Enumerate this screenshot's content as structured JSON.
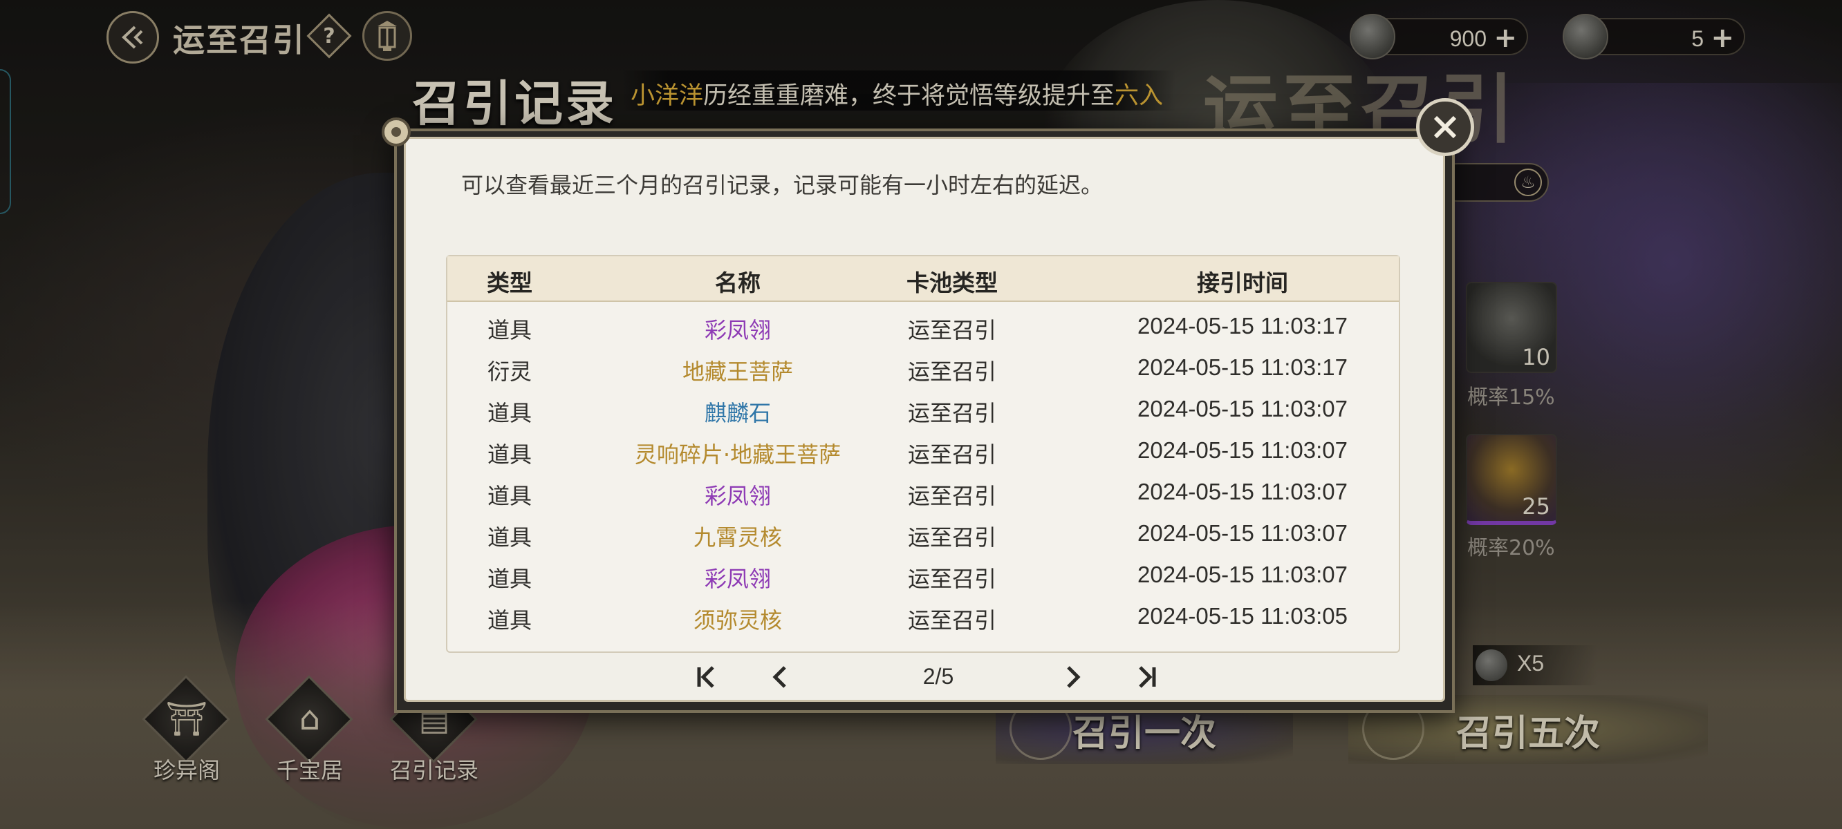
{
  "header": {
    "title": "运至召引",
    "help_label": "?",
    "currencies": [
      {
        "icon": "jade-coin-icon",
        "value": "900",
        "plus": "+"
      },
      {
        "icon": "spirit-token-icon",
        "value": "5",
        "plus": "+"
      }
    ]
  },
  "broadcast": {
    "name": "小洋洋",
    "text": "历经重重磨难，终于将觉悟等级提升至",
    "level": "六入"
  },
  "banner": {
    "title": "运至召引"
  },
  "pool_panel": {
    "rewards": [
      {
        "icon": "lotus-chest-icon",
        "count": "10",
        "rate": "概率15%"
      },
      {
        "icon": "feather-icon",
        "count": "25",
        "rate": "概率20%"
      }
    ],
    "cost_label": "X5",
    "summon_one": "召引一次",
    "summon_five": "召引五次"
  },
  "bottom_nav": [
    {
      "label": "珍异阁",
      "icon": "merchant-hat-icon"
    },
    {
      "label": "千宝居",
      "icon": "pavilion-icon"
    },
    {
      "label": "召引记录",
      "icon": "record-book-icon"
    }
  ],
  "modal": {
    "title": "召引记录",
    "description": "可以查看最近三个月的召引记录，记录可能有一小时左右的延迟。",
    "columns": [
      "类型",
      "名称",
      "卡池类型",
      "接引时间"
    ],
    "rows": [
      {
        "type": "道具",
        "name": "彩凤翎",
        "pool": "运至召引",
        "time": "2024-05-15 11:03:17",
        "color": "#8e3bb5"
      },
      {
        "type": "衍灵",
        "name": "地藏王菩萨",
        "pool": "运至召引",
        "time": "2024-05-15 11:03:17",
        "color": "#b48a2e"
      },
      {
        "type": "道具",
        "name": "麒麟石",
        "pool": "运至召引",
        "time": "2024-05-15 11:03:07",
        "color": "#2f76a8"
      },
      {
        "type": "道具",
        "name": "灵响碎片·地藏王菩萨",
        "pool": "运至召引",
        "time": "2024-05-15 11:03:07",
        "color": "#b48a2e"
      },
      {
        "type": "道具",
        "name": "彩凤翎",
        "pool": "运至召引",
        "time": "2024-05-15 11:03:07",
        "color": "#8e3bb5"
      },
      {
        "type": "道具",
        "name": "九霄灵核",
        "pool": "运至召引",
        "time": "2024-05-15 11:03:07",
        "color": "#b48a2e"
      },
      {
        "type": "道具",
        "name": "彩凤翎",
        "pool": "运至召引",
        "time": "2024-05-15 11:03:07",
        "color": "#8e3bb5"
      },
      {
        "type": "道具",
        "name": "须弥灵核",
        "pool": "运至召引",
        "time": "2024-05-15 11:03:05",
        "color": "#b48a2e"
      }
    ],
    "pagination": {
      "current": 2,
      "total": 5,
      "label": "2/5"
    }
  },
  "colors": {
    "rarity_purple": "#8e3bb5",
    "rarity_gold": "#b48a2e",
    "rarity_blue": "#2f76a8",
    "highlight": "#e5b53c"
  }
}
